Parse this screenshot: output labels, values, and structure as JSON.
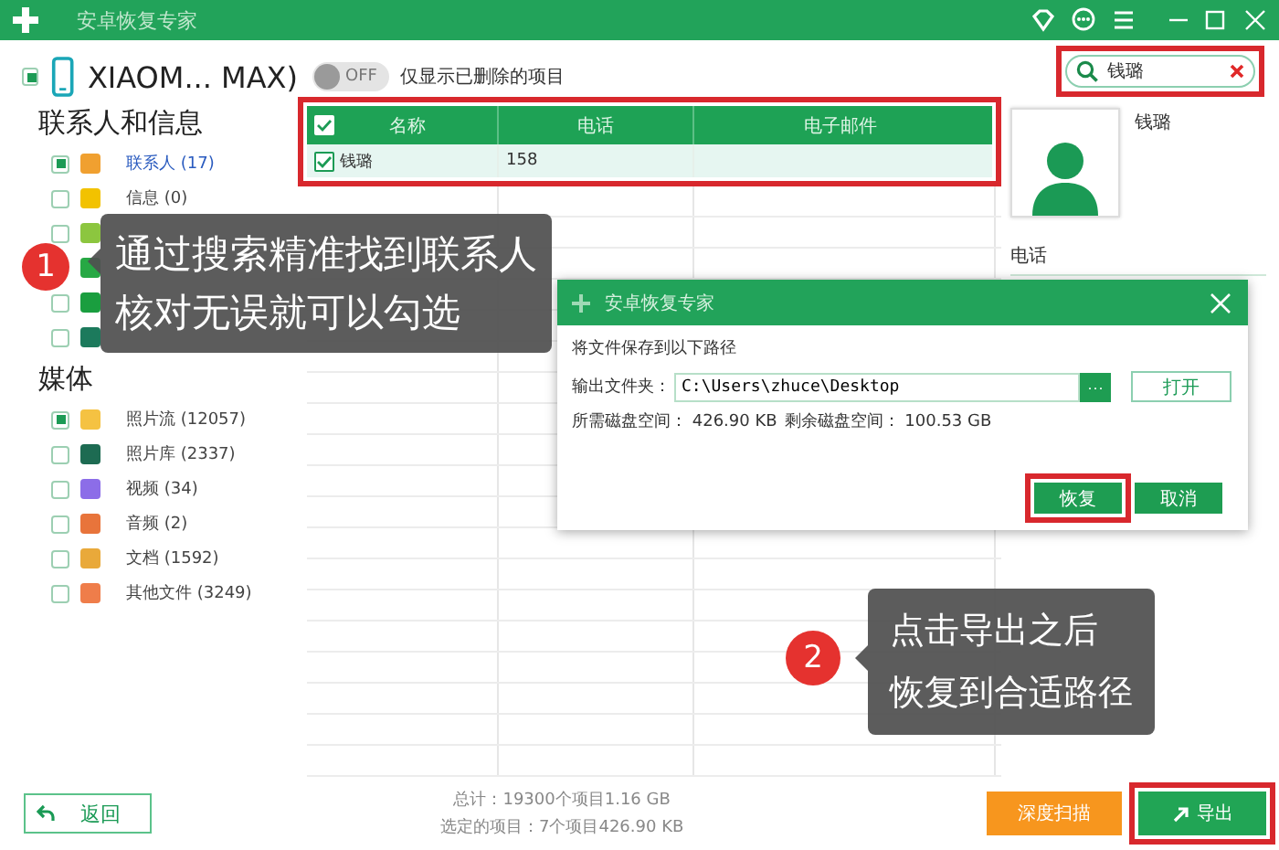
{
  "window": {
    "title": "安卓恢复专家"
  },
  "device": {
    "name": "XIAOM... MAX)",
    "checked": true
  },
  "deleted_only_toggle": {
    "state": "OFF",
    "on": false,
    "label": "仅显示已删除的项目"
  },
  "search": {
    "value": "钱璐",
    "highlighted": true
  },
  "sidebar": {
    "sections": [
      {
        "title": "联系人和信息",
        "items": [
          {
            "label": "联系人 (17)",
            "checked": true,
            "selected": true
          },
          {
            "label": "信息 (0)",
            "checked": false,
            "selected": false
          },
          {
            "checked": false,
            "selected": false
          },
          {
            "selected": false
          },
          {
            "checked": false,
            "selected": false
          },
          {
            "checked": false,
            "selected": false
          }
        ]
      },
      {
        "title": "媒体",
        "items": [
          {
            "label": "照片流 (12057)",
            "checked": true,
            "selected": false
          },
          {
            "label": "照片库 (2337)",
            "checked": false,
            "selected": false
          },
          {
            "label": "视频 (34)",
            "checked": false,
            "selected": false
          },
          {
            "label": "音频 (2)",
            "checked": false,
            "selected": false
          },
          {
            "label": "文档 (1592)",
            "checked": false,
            "selected": false
          },
          {
            "label": "其他文件 (3249)",
            "checked": false,
            "selected": false
          }
        ]
      }
    ]
  },
  "table": {
    "highlighted": true,
    "header_checked": true,
    "columns": [
      "名称",
      "电话",
      "电子邮件"
    ],
    "rows": [
      {
        "cells": [
          "钱璐",
          "158"
        ],
        "checked": true,
        "selected": true
      }
    ]
  },
  "contact_detail": {
    "name": "钱璐",
    "field_label": "电话"
  },
  "dialog": {
    "title": "安卓恢复专家",
    "prompt": "将文件保存到以下路径",
    "folder_label": "输出文件夹：",
    "folder_value": "C:\\Users\\zhuce\\Desktop",
    "browse": "···",
    "open": "打开",
    "required_space": "所需磁盘空间： 426.90 KB",
    "free_space": "剩余磁盘空间： 100.53 GB",
    "buttons": [
      {
        "label": "恢复",
        "highlighted": true
      },
      {
        "label": "取消",
        "highlighted": false
      }
    ]
  },
  "footer": {
    "back": "返回",
    "total": "总计：19300个项目1.16 GB",
    "selected_summary": "选定的项目：7个项目426.90 KB",
    "buttons": [
      {
        "label": "深度扫描",
        "kind": "scan",
        "highlighted": false
      },
      {
        "label": "导出",
        "kind": "export",
        "highlighted": true
      }
    ]
  },
  "tips": [
    {
      "number": "1",
      "lines": [
        "通过搜索精准找到联系人",
        "核对无误就可以勾选"
      ]
    },
    {
      "number": "2",
      "lines": [
        "点击导出之后",
        "恢复到合适路径"
      ]
    }
  ]
}
